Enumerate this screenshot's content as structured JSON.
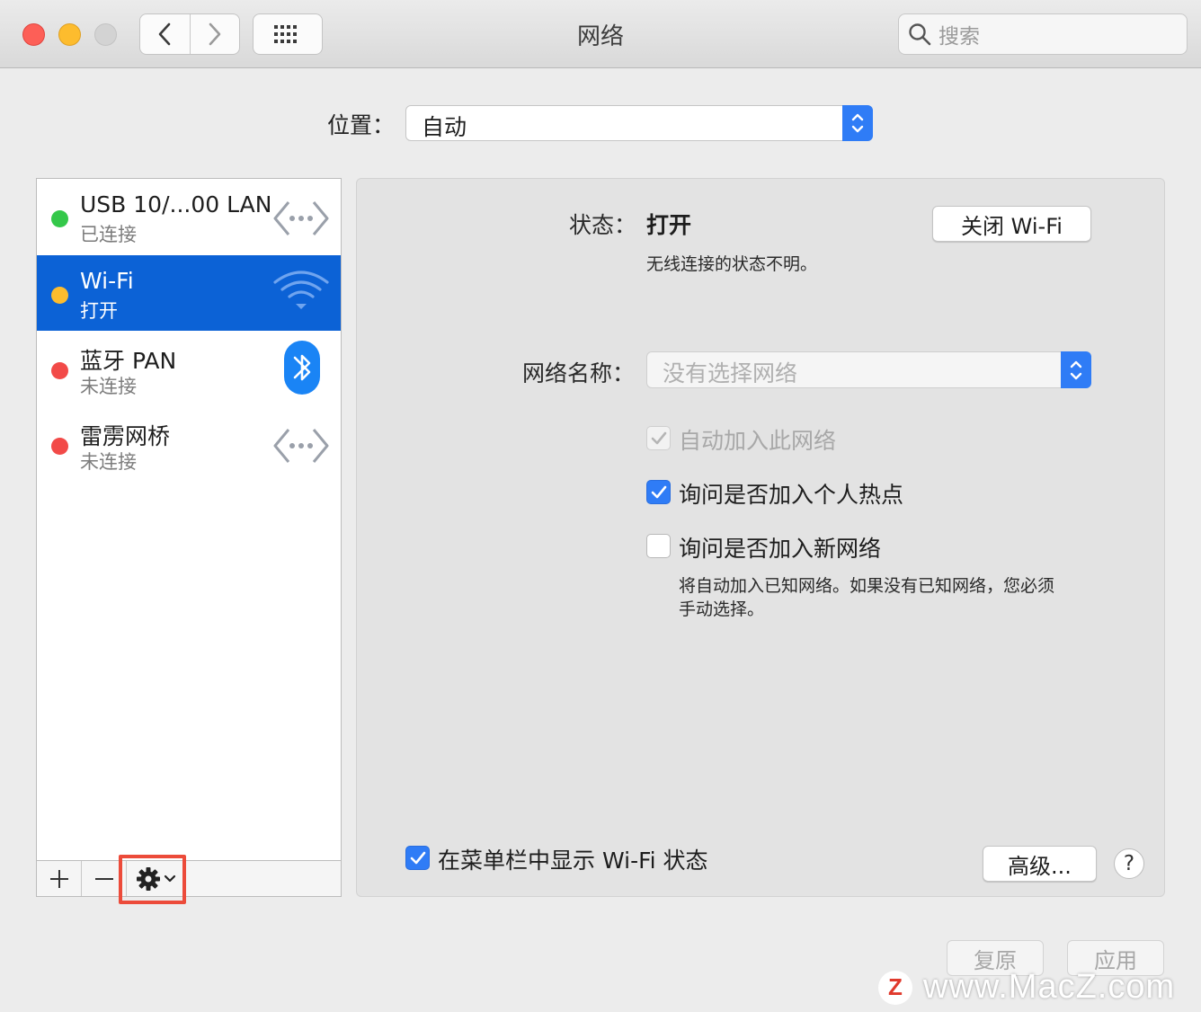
{
  "window": {
    "title": "网络",
    "search_placeholder": "搜索"
  },
  "location": {
    "label": "位置：",
    "value": "自动"
  },
  "services": [
    {
      "name": "USB 10/...00 LAN",
      "status": "已连接",
      "dot_color": "#34c84a",
      "icon": "ethernet-icon"
    },
    {
      "name": "Wi-Fi",
      "status": "打开",
      "dot_color": "#fdbc2e",
      "icon": "wifi-icon",
      "selected": true
    },
    {
      "name": "蓝牙 PAN",
      "status": "未连接",
      "dot_color": "#f24a48",
      "icon": "bluetooth-icon"
    },
    {
      "name": "雷雳网桥",
      "status": "未连接",
      "dot_color": "#f24a48",
      "icon": "ethernet-icon"
    }
  ],
  "sidebar_toolbar": {
    "add": "+",
    "remove": "−"
  },
  "detail": {
    "status_label": "状态：",
    "status_value": "打开",
    "status_desc": "无线连接的状态不明。",
    "turn_off_button": "关闭 Wi-Fi",
    "network_name_label": "网络名称：",
    "network_name_placeholder": "没有选择网络",
    "options": {
      "auto_join": {
        "label": "自动加入此网络",
        "checked": true,
        "disabled": true
      },
      "ask_hotspot": {
        "label": "询问是否加入个人热点",
        "checked": true
      },
      "ask_new": {
        "label": "询问是否加入新网络",
        "checked": false
      }
    },
    "ask_new_desc_line1": "将自动加入已知网络。如果没有已知网络，您必须",
    "ask_new_desc_line2": "手动选择。",
    "menubar_label": "在菜单栏中显示 Wi-Fi 状态",
    "menubar_checked": true,
    "advanced_button": "高级...",
    "help_button": "?"
  },
  "footer": {
    "revert_button": "复原",
    "apply_button": "应用"
  },
  "watermark": {
    "logo": "Z",
    "text": "www.MacZ.com"
  },
  "colors": {
    "accent": "#2f7cf6",
    "selection": "#0c62d6",
    "highlight_box": "#ec4b3a"
  }
}
